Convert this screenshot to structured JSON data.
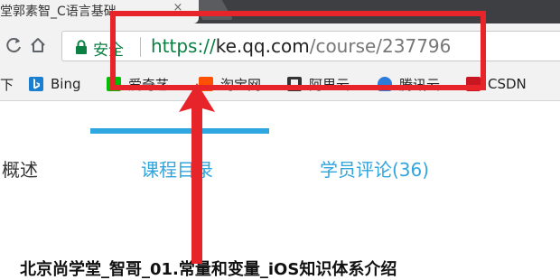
{
  "browser": {
    "tab": {
      "title": "堂郭素智_C语言基础",
      "close_glyph": "×"
    },
    "address_bar": {
      "secure_label": "安全",
      "url_scheme": "https://",
      "url_host": "ke.qq.com",
      "url_path": "/course/237796"
    },
    "bookmarks": [
      {
        "label": "下",
        "icon": "truncated"
      },
      {
        "label": "Bing",
        "icon": "bing-icon"
      },
      {
        "label": "爱奇艺",
        "icon": "iqiyi-icon"
      },
      {
        "label": "淘宝网",
        "icon": "taobao-icon"
      },
      {
        "label": "阿里云",
        "icon": "aliyun-icon"
      },
      {
        "label": "腾讯云",
        "icon": "tencent-cloud-icon"
      },
      {
        "label": "CSDN",
        "icon": "csdn-icon"
      }
    ]
  },
  "course_page": {
    "tabs": [
      {
        "label": "概述",
        "active": false
      },
      {
        "label": "课程目录",
        "active": true
      },
      {
        "label": "学员评论(36)",
        "active": false
      }
    ],
    "lesson_title": "北京尚学堂_智哥_01.常量和变量_iOS知识体系介绍"
  },
  "colors": {
    "annotation_red": "#e8242b",
    "secure_green": "#0b8043",
    "tab_blue": "#2ea7e0",
    "tab_blue_text": "#31a5dc"
  }
}
